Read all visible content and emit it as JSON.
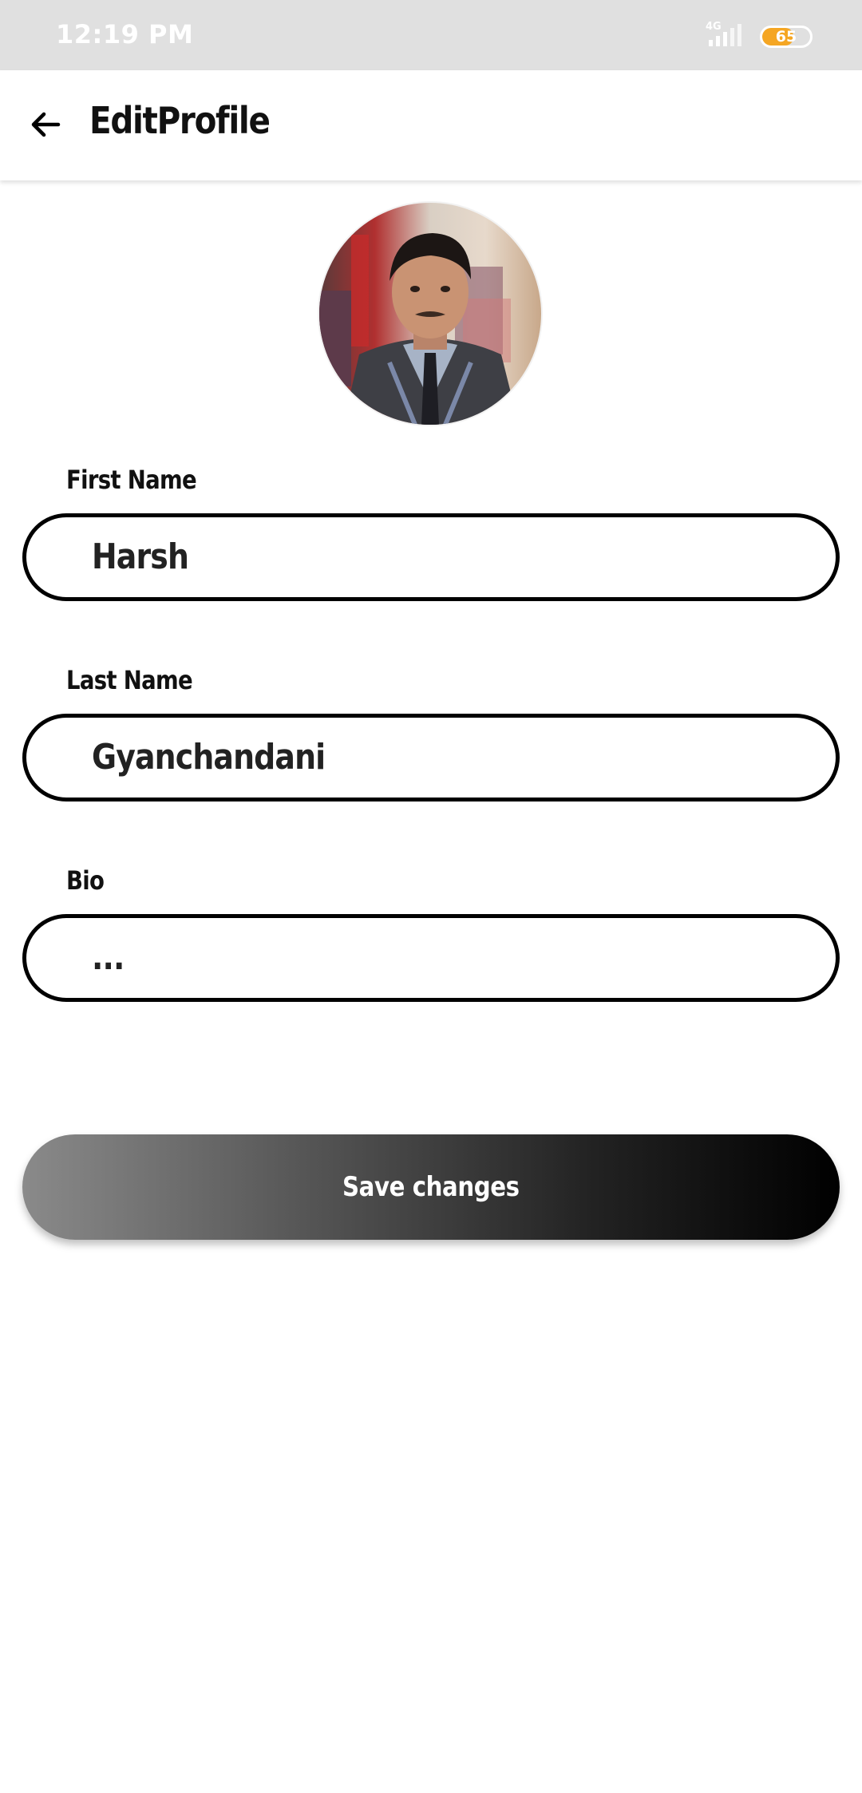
{
  "status_bar": {
    "time": "12:19 PM",
    "network": "4G",
    "battery_percent": 65,
    "battery_label": "65"
  },
  "app_bar": {
    "back_icon": "arrow-left-icon",
    "title": "EditProfile"
  },
  "profile": {
    "avatar_icon": "profile-photo"
  },
  "form": {
    "first_name": {
      "label": "First Name",
      "value": "Harsh"
    },
    "last_name": {
      "label": "Last Name",
      "value": "Gyanchandani"
    },
    "bio": {
      "label": "Bio",
      "value": "..."
    }
  },
  "actions": {
    "save_label": "Save changes"
  },
  "colors": {
    "status_bar_bg": "#e0e0e0",
    "battery_accent": "#f5a623",
    "field_border": "#000000",
    "button_gradient_start": "#8a8a8a",
    "button_gradient_end": "#000000"
  }
}
